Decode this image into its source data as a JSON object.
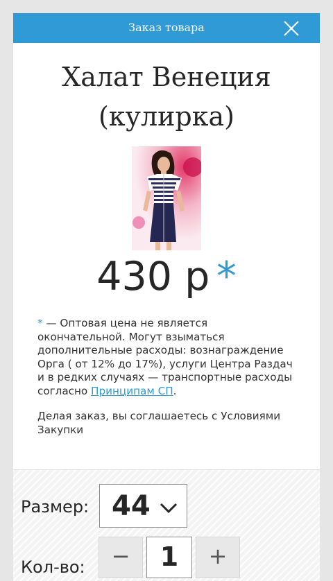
{
  "header": {
    "title": "Заказ товара",
    "close_icon": "close-icon"
  },
  "product": {
    "title_line1": "Халат Венеция",
    "title_line2": "(кулирка)",
    "price": "430 р",
    "price_asterisk": "*"
  },
  "notice": {
    "asterisk": "*",
    "text_before_link": " — Оптовая цена не является окончательной. Могут взыматься дополнительные расходы: вознаграждение Орга ( от 12% до 17%), услуги Центра Раздач и в редких случаях — транспортные расходы согласно ",
    "link_text": "Принципам СП",
    "text_after_link": ".",
    "agreement": "Делая заказ, вы соглашаетесь с Условиями Закупки"
  },
  "form": {
    "size_label": "Размер:",
    "size_value": "44",
    "size_chevron_icon": "chevron-down-icon",
    "qty_label": "Кол-во:",
    "qty_minus": "−",
    "qty_value": "1",
    "qty_plus": "+"
  },
  "colors": {
    "accent": "#2f9ad6",
    "text": "#262626"
  }
}
